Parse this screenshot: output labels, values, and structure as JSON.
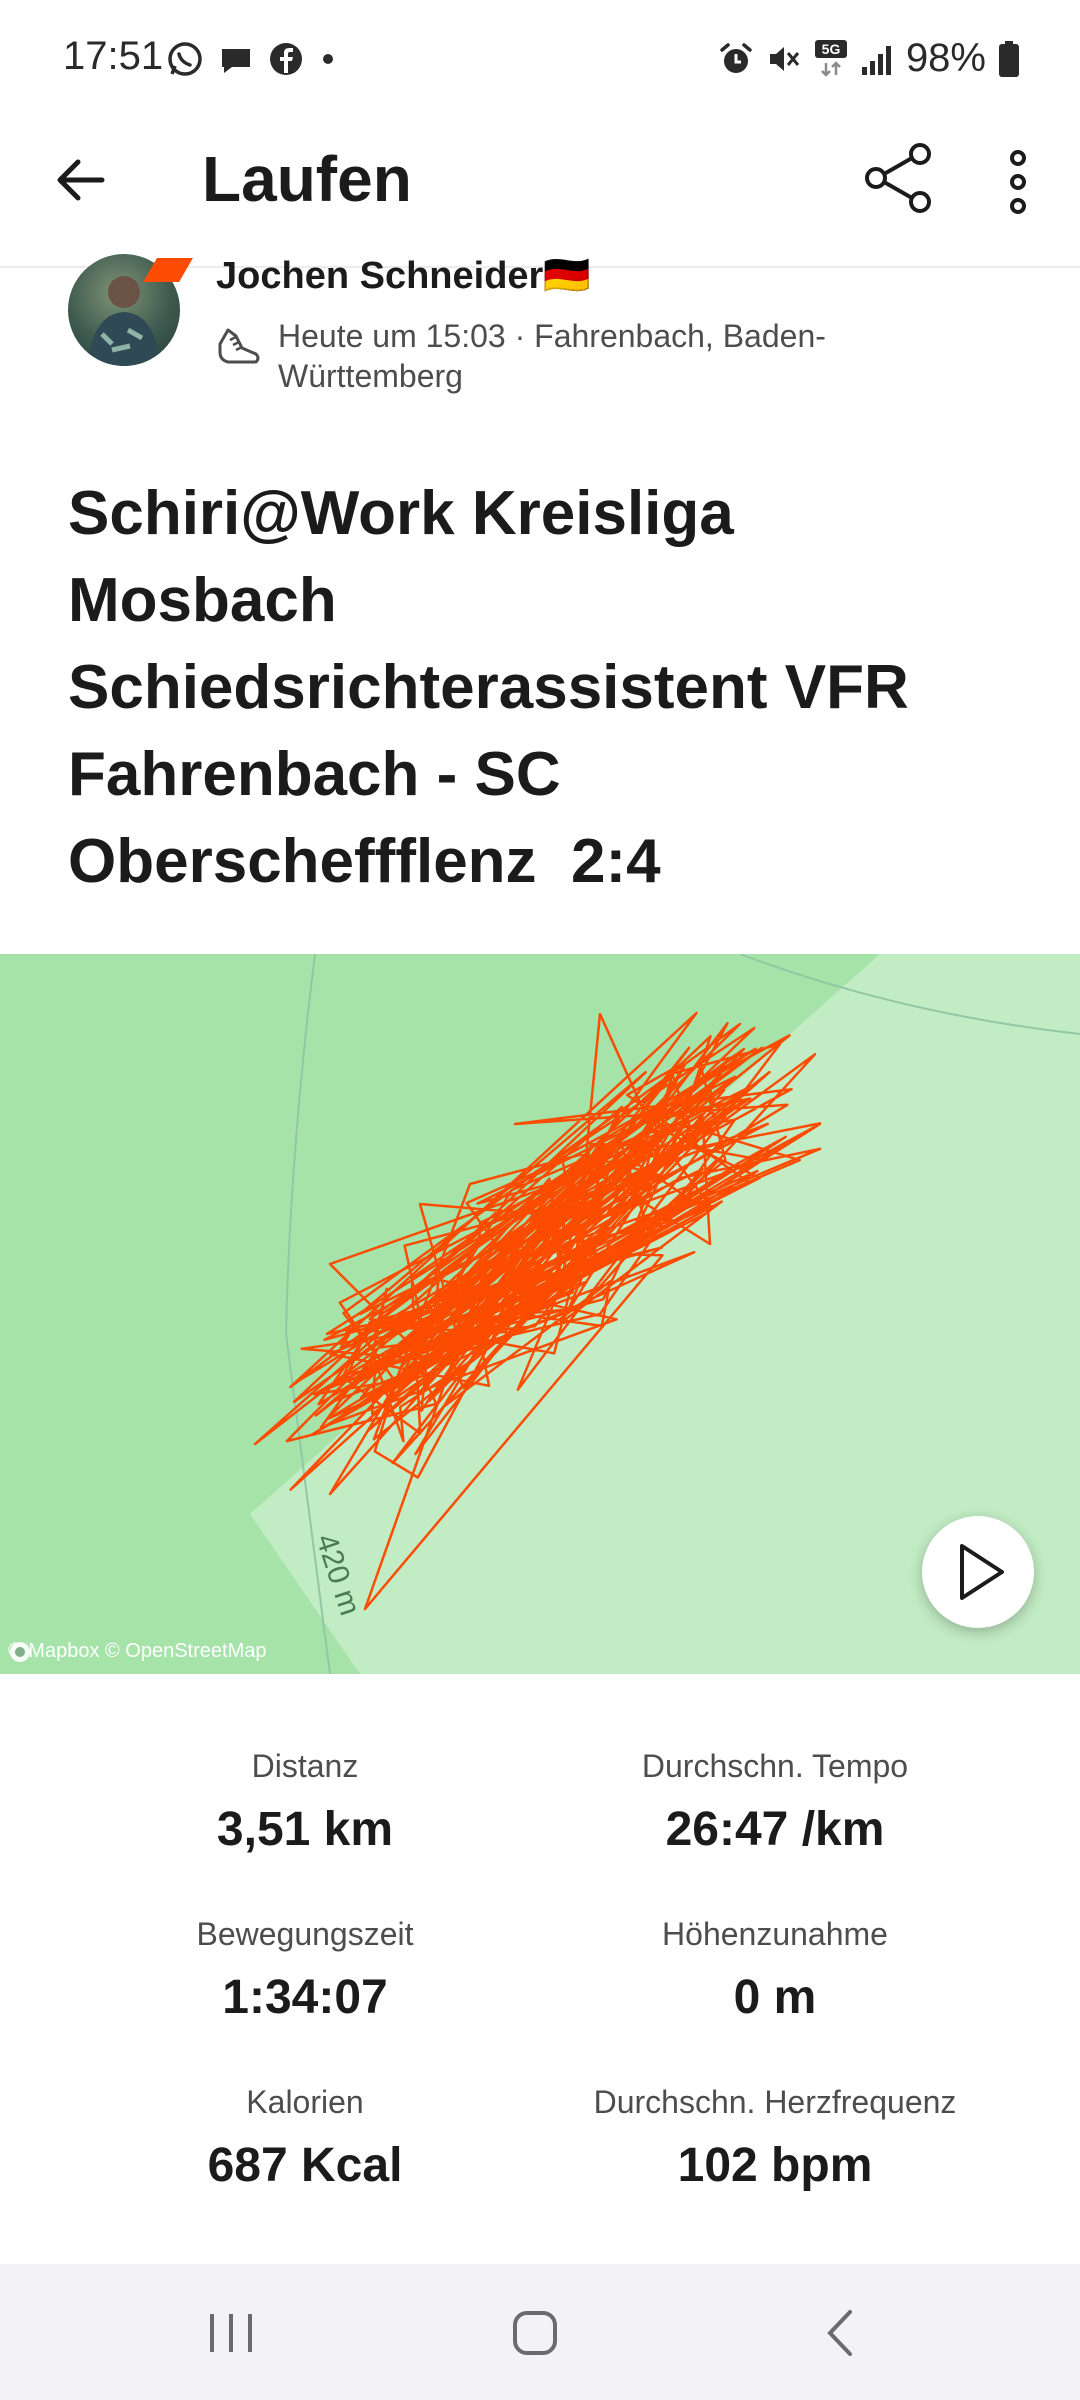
{
  "status_bar": {
    "time": "17:51",
    "notification_icons": [
      "whatsapp-icon",
      "chat-icon",
      "facebook-icon",
      "dot-icon"
    ],
    "system_icons": [
      "alarm-icon",
      "mute-icon",
      "5g-icon",
      "signal-icon",
      "battery-icon"
    ],
    "network_label": "5G",
    "battery": "98%"
  },
  "header": {
    "title": "Laufen",
    "back_icon": "arrow-left-icon",
    "share_icon": "share-icon",
    "more_icon": "more-vertical-icon"
  },
  "athlete": {
    "name": "Jochen Schneider🇩🇪",
    "meta": "Heute um 15:03 · Fahrenbach, Baden-Württemberg",
    "activity_icon": "shoe-icon"
  },
  "activity": {
    "title": "Schiri@Work Kreisliga Mosbach Schiedsrichterassistent VFR Fahrenbach - SC Oberscheffflenz  2:4"
  },
  "map": {
    "attribution": "© Mapbox © OpenStreetMap",
    "scale_label": "420 m",
    "route_color": "#fc4c02",
    "play_icon": "play-icon"
  },
  "stats": [
    {
      "label": "Distanz",
      "value": "3,51 km"
    },
    {
      "label": "Durchschn. Tempo",
      "value": "26:47 /km"
    },
    {
      "label": "Bewegungszeit",
      "value": "1:34:07"
    },
    {
      "label": "Höhenzunahme",
      "value": "0 m"
    },
    {
      "label": "Kalorien",
      "value": "687 Kcal"
    },
    {
      "label": "Durchschn. Herzfrequenz",
      "value": "102 bpm"
    }
  ],
  "nav_bar": {
    "buttons": [
      "recent-apps-icon",
      "home-icon",
      "back-icon"
    ]
  },
  "colors": {
    "accent": "#fc4c02",
    "map_bg": "#c2ecc4",
    "map_park": "#a6e3a9"
  }
}
